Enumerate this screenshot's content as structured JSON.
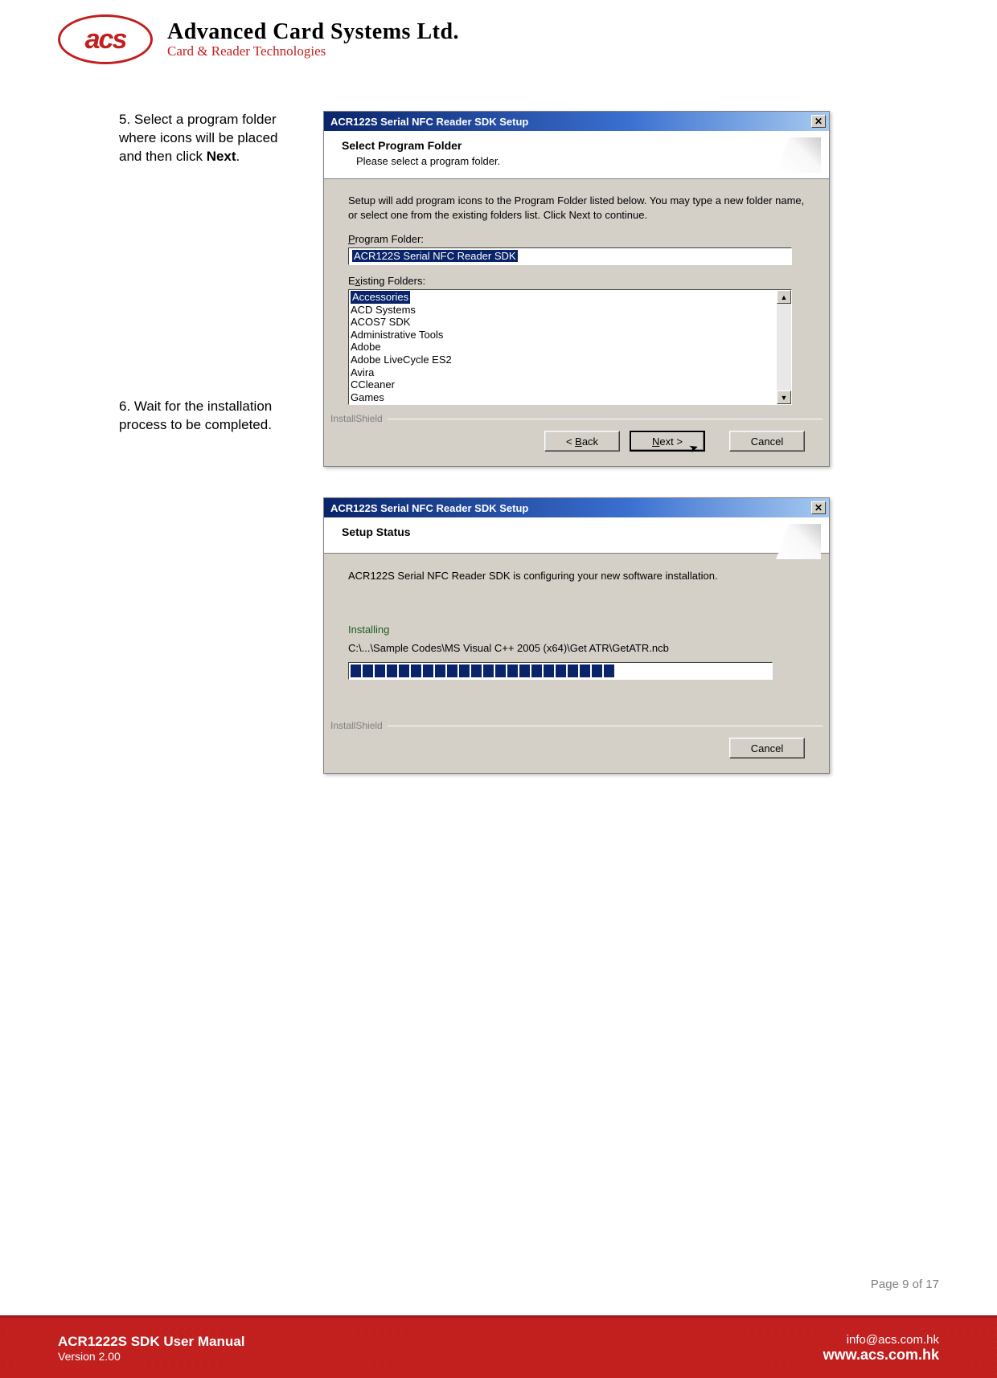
{
  "logo": {
    "abbrev": "acs",
    "name": "Advanced Card Systems Ltd.",
    "tagline": "Card & Reader Technologies"
  },
  "step5": {
    "num": "5.",
    "text": " Select a program folder where icons will be placed and then click ",
    "bold": "Next",
    "tail": "."
  },
  "step6": {
    "num": "6.",
    "text": " Wait for the installation process to be completed."
  },
  "dlg1": {
    "title": "ACR122S Serial NFC Reader SDK Setup",
    "header": "Select Program Folder",
    "sub": "Please select a program folder.",
    "body": "Setup will add program icons to the Program Folder listed below.  You may type a new folder name, or select one from the existing folders list.  Click Next to continue.",
    "pf_label": "Program Folder:",
    "pf_value": "ACR122S Serial NFC Reader SDK",
    "ex_label": "Existing Folders:",
    "folders": [
      "Accessories",
      "ACD Systems",
      "ACOS7 SDK",
      "Administrative Tools",
      "Adobe",
      "Adobe LiveCycle ES2",
      "Avira",
      "CCleaner",
      "Games"
    ],
    "shield": "InstallShield",
    "back": "< Back",
    "next": "Next >",
    "cancel": "Cancel"
  },
  "dlg2": {
    "title": "ACR122S Serial NFC Reader SDK Setup",
    "header": "Setup Status",
    "status": "ACR122S Serial NFC Reader SDK is configuring your new software installation.",
    "installing": "Installing",
    "path": "C:\\...\\Sample Codes\\MS Visual C++ 2005 (x64)\\Get ATR\\GetATR.ncb",
    "shield": "InstallShield",
    "cancel": "Cancel"
  },
  "footer": {
    "page": "Page 9 of 17",
    "title": "ACR1222S SDK User Manual",
    "version": "Version 2.00",
    "email": "info@acs.com.hk",
    "website": "www.acs.com.hk"
  }
}
